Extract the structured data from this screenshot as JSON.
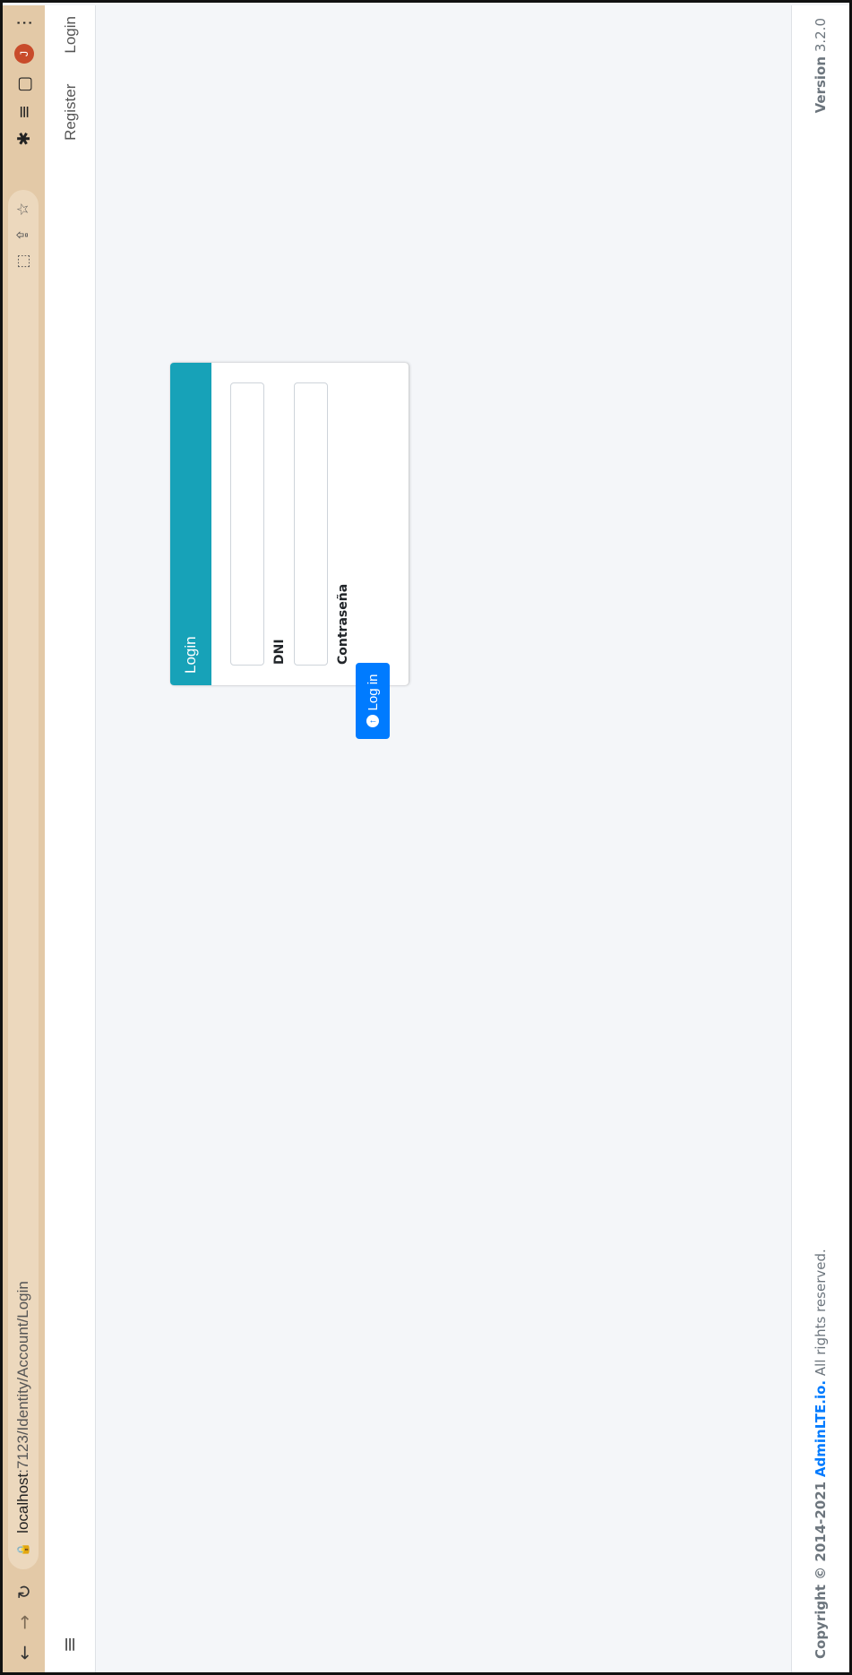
{
  "browser": {
    "url_host": "localhost",
    "url_path": ":7123/Identity/Account/Login",
    "avatar_letter": "J"
  },
  "navbar": {
    "register": "Register",
    "login": "Login"
  },
  "card": {
    "title": "Login",
    "fields": [
      {
        "label": "DNI",
        "value": ""
      },
      {
        "label": "Contraseña",
        "value": ""
      }
    ],
    "button": "Log in"
  },
  "footer": {
    "copyright_prefix": "Copyright © 2014-2021",
    "brand": "AdminLTE.io.",
    "rights": "All rights reserved.",
    "version_label": "Version",
    "version_number": "3.2.0"
  },
  "colors": {
    "toolbar": "#e3c9a7",
    "card_header": "#17a2b8",
    "primary": "#007bff"
  }
}
